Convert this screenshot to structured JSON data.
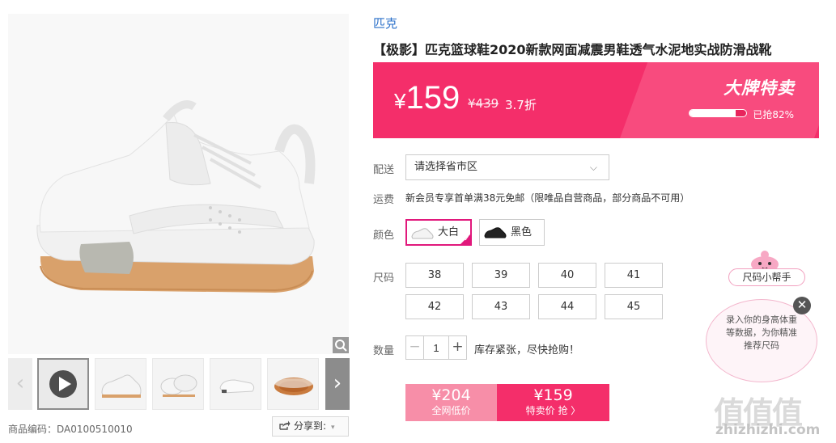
{
  "gallery": {
    "thumbs": [
      "video-thumb",
      "shoe-side",
      "shoe-top-pair",
      "shoe-sole-side",
      "shoe-outsole"
    ],
    "sku_label": "商品编码：",
    "sku_value": "DA0100510010",
    "share_label": "分享到:"
  },
  "product": {
    "brand": "匹克",
    "title": "【极影】匹克篮球鞋2020新款网面减震男鞋透气水泥地实战防滑战靴"
  },
  "price_banner": {
    "currency": "¥",
    "price": "159",
    "original_price": "¥439",
    "discount": "3.7折",
    "promo_label": "大牌特卖",
    "sold_text": "已抢82%",
    "sold_fraction": 0.82,
    "color": "#f42e6a"
  },
  "shipping": {
    "label": "配送",
    "select_placeholder": "请选择省市区",
    "fee_label": "运费",
    "fee_text": "新会员专享首单满38元免邮（限唯品自营商品，部分商品不可用）"
  },
  "color": {
    "label": "颜色",
    "options": [
      {
        "name": "大白",
        "selected": true
      },
      {
        "name": "黑色",
        "selected": false
      }
    ]
  },
  "size": {
    "label": "尺码",
    "options": [
      "38",
      "39",
      "40",
      "41",
      "42",
      "43",
      "44",
      "45"
    ]
  },
  "quantity": {
    "label": "数量",
    "minus": "−",
    "plus": "+",
    "value": "1",
    "stock_text": "库存紧张，尽快抢购！"
  },
  "buy": {
    "left_price": "¥204",
    "left_sub": "全网低价",
    "right_price": "¥159",
    "right_sub": "特卖价 抢 〉"
  },
  "helper": {
    "title": "尺码小帮手",
    "text": "录入你的身高体重等数据，为你精准推荐尺码",
    "close": "✕"
  },
  "watermark": {
    "logo": "值值值",
    "url": "zhizhizhi.com"
  },
  "icons": [
    "search-icon",
    "play-icon",
    "chevron-left-icon",
    "chevron-right-icon",
    "share-icon",
    "chevron-down-icon",
    "check-icon",
    "close-icon"
  ]
}
